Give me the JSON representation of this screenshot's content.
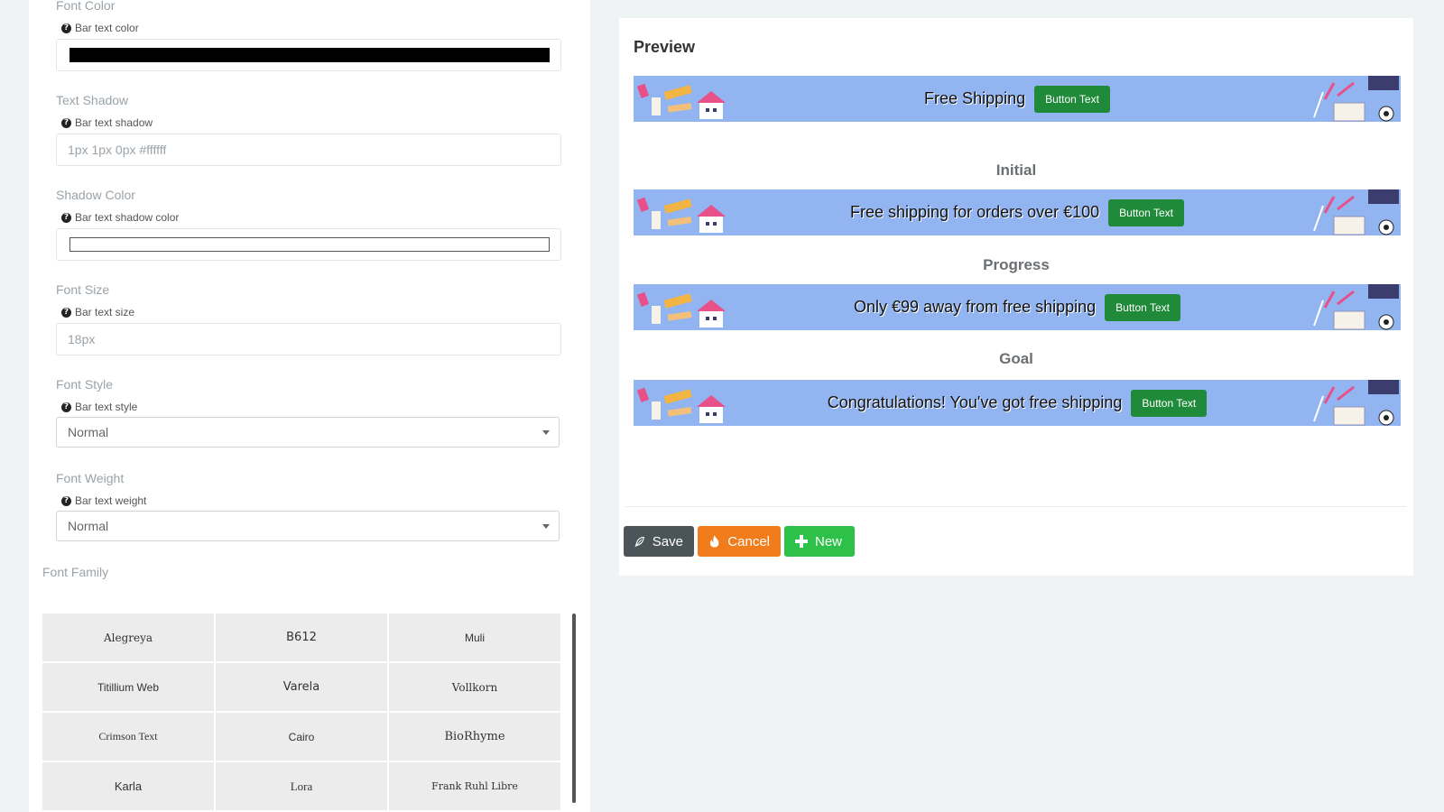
{
  "settings": {
    "font_color": {
      "label": "Font Color",
      "hint": "Bar text color",
      "value_color": "#000000"
    },
    "text_shadow": {
      "label": "Text Shadow",
      "hint": "Bar text shadow",
      "placeholder": "1px 1px 0px #ffffff"
    },
    "shadow_color": {
      "label": "Shadow Color",
      "hint": "Bar text shadow color",
      "value_color": "#ffffff"
    },
    "font_size": {
      "label": "Font Size",
      "hint": "Bar text size",
      "placeholder": "18px"
    },
    "font_style": {
      "label": "Font Style",
      "hint": "Bar text style",
      "selected": "Normal"
    },
    "font_weight": {
      "label": "Font Weight",
      "hint": "Bar text weight",
      "selected": "Normal"
    },
    "font_family": {
      "label": "Font Family",
      "fonts": [
        "Alegreya",
        "B612",
        "Muli",
        "Titillium Web",
        "Varela",
        "Vollkorn",
        "Crimson Text",
        "Cairo",
        "BioRhyme",
        "Karla",
        "Lora",
        "Frank Ruhl Libre"
      ]
    }
  },
  "preview": {
    "title": "Preview",
    "button_text": "Button Text",
    "bars": [
      {
        "state": "",
        "message": "Free Shipping"
      },
      {
        "state": "Initial",
        "message": "Free shipping for orders over €100"
      },
      {
        "state": "Progress",
        "message": "Only €99 away from free shipping"
      },
      {
        "state": "Goal",
        "message": "Congratulations! You've got free shipping"
      }
    ],
    "bar_color": "#92b4f0",
    "button_color": "#1f8a3a"
  },
  "actions": {
    "save": "Save",
    "cancel": "Cancel",
    "new": "New"
  },
  "colors": {
    "save": "#4b5458",
    "cancel": "#f07c1b",
    "new": "#2ec14a"
  }
}
